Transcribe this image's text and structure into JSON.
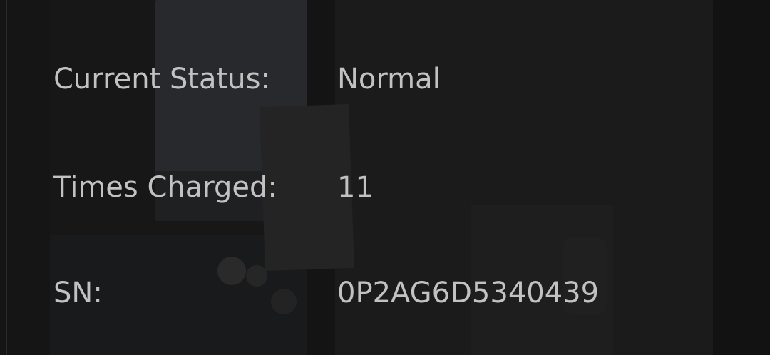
{
  "battery_info": {
    "rows": [
      {
        "label": "Current Status:",
        "value": "Normal"
      },
      {
        "label": "Times Charged:",
        "value": "11"
      },
      {
        "label": "SN:",
        "value": "0P2AG6D5340439"
      }
    ]
  },
  "colors": {
    "text": "#c2c2c2",
    "background": "#171717"
  }
}
